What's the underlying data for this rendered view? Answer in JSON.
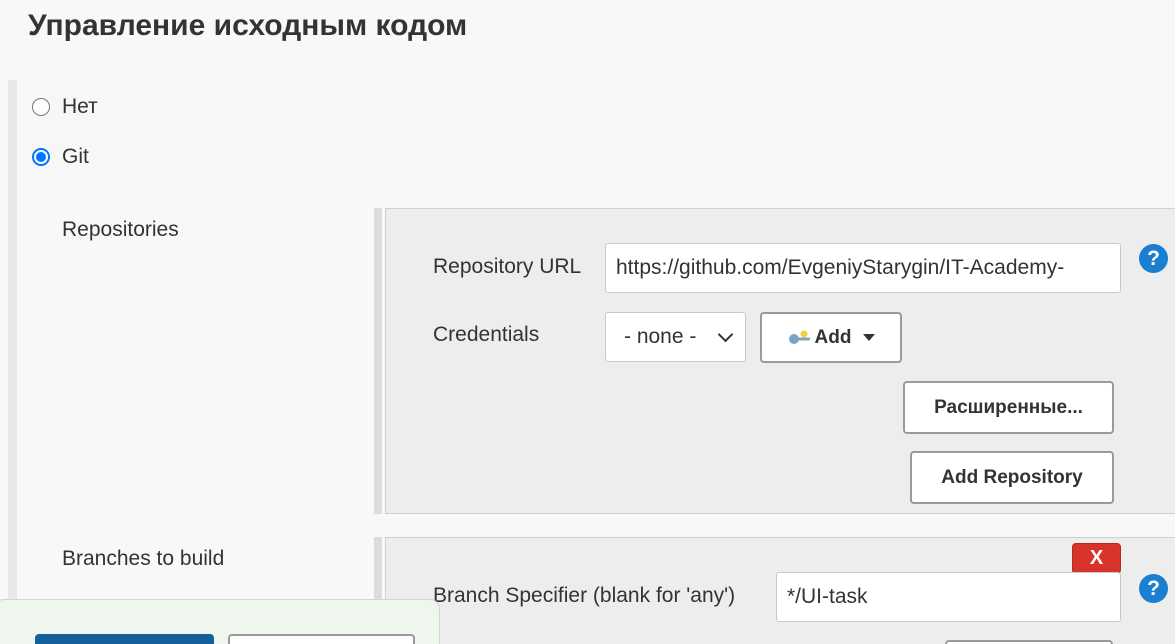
{
  "section": {
    "title": "Управление исходным кодом"
  },
  "scm": {
    "options": [
      {
        "label": "Нет",
        "selected": false
      },
      {
        "label": "Git",
        "selected": true
      }
    ]
  },
  "repositories": {
    "label": "Repositories",
    "repository_url_label": "Repository URL",
    "repository_url_value": "https://github.com/EvgeniyStarygin/IT-Academy-",
    "credentials_label": "Credentials",
    "credentials_selected": "- none -",
    "add_label": "Add",
    "advanced_label": "Расширенные...",
    "add_repository_label": "Add Repository"
  },
  "branches": {
    "label": "Branches to build",
    "delete_label": "X",
    "branch_specifier_label": "Branch Specifier (blank for 'any')",
    "branch_specifier_value": "*/UI-task"
  },
  "help": {
    "symbol": "?"
  },
  "colors": {
    "accent": "#0075ff",
    "help": "#1a7fd1",
    "delete": "#d9342b",
    "save": "#14609a"
  }
}
